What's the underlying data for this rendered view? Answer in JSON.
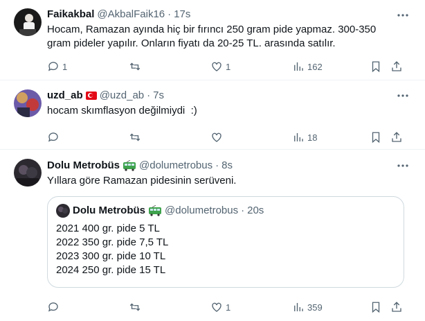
{
  "tweets": [
    {
      "name": "Faikakbal",
      "handle": "@AkbalFaik16",
      "sep": "·",
      "time": "17s",
      "text": "Hocam, Ramazan ayında hiç bir fırıncı 250 gram pide yapmaz. 300-350 gram pideler yapılır. Onların fiyatı da 20-25 TL. arasında satılır.",
      "replies": "1",
      "retweets": "",
      "likes": "1",
      "views": "162"
    },
    {
      "name": "uzd_ab",
      "flag": "turkey-flag",
      "handle": "@uzd_ab",
      "sep": "·",
      "time": "7s",
      "text": "hocam skımflasyon değilmiydi  :)",
      "replies": "",
      "retweets": "",
      "likes": "",
      "views": "18"
    },
    {
      "name": "Dolu Metrobüs",
      "emoji": "trolleybus-emoji",
      "handle": "@dolumetrobus",
      "sep": "·",
      "time": "8s",
      "text": "Yıllara göre Ramazan pidesinin serüveni.",
      "quote": {
        "name": "Dolu Metrobüs",
        "handle": "@dolumetrobus",
        "sep": "·",
        "time": "20s",
        "lines": [
          "2021 400 gr. pide 5 TL",
          "2022 350 gr. pide 7,5 TL",
          "2023 300 gr. pide 10 TL",
          "2024 250 gr. pide 15 TL"
        ]
      },
      "replies": "",
      "retweets": "",
      "likes": "1",
      "views": "359"
    }
  ],
  "colors": {
    "text": "#0f1419",
    "muted": "#536471",
    "border": "#eff3f4",
    "quote_border": "#cfd9de"
  }
}
